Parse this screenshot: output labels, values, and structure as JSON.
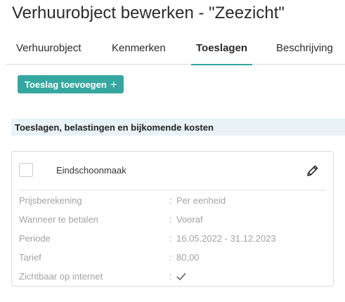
{
  "page": {
    "title": "Verhuurobject bewerken - \"Zeezicht\""
  },
  "tabs": [
    {
      "label": "Verhuurobject",
      "active": false
    },
    {
      "label": "Kenmerken",
      "active": false
    },
    {
      "label": "Toeslagen",
      "active": true
    },
    {
      "label": "Beschrijving",
      "active": false
    }
  ],
  "toolbar": {
    "add_label": "Toeslag toevoegen",
    "add_icon": "+"
  },
  "section": {
    "title": "Toeslagen, belastingen en bijkomende kosten"
  },
  "item": {
    "name": "Eindschoonmaak",
    "selected": false,
    "edit_icon": "pencil-icon",
    "separator": ":",
    "details": [
      {
        "label": "Prijsberekening",
        "value": "Per eenheid"
      },
      {
        "label": "Wanneer te betalen",
        "value": "Vooraf"
      },
      {
        "label": "Periode",
        "value": "16.05.2022 - 31.12.2023"
      },
      {
        "label": "Tarief",
        "value": "80,00"
      },
      {
        "label": "Zichtbaar op internet",
        "value_icon": "checkmark-icon"
      }
    ]
  },
  "colors": {
    "accent": "#35a7a0",
    "section_bg": "#e8f2f7",
    "muted_text": "#a3a3a3"
  }
}
